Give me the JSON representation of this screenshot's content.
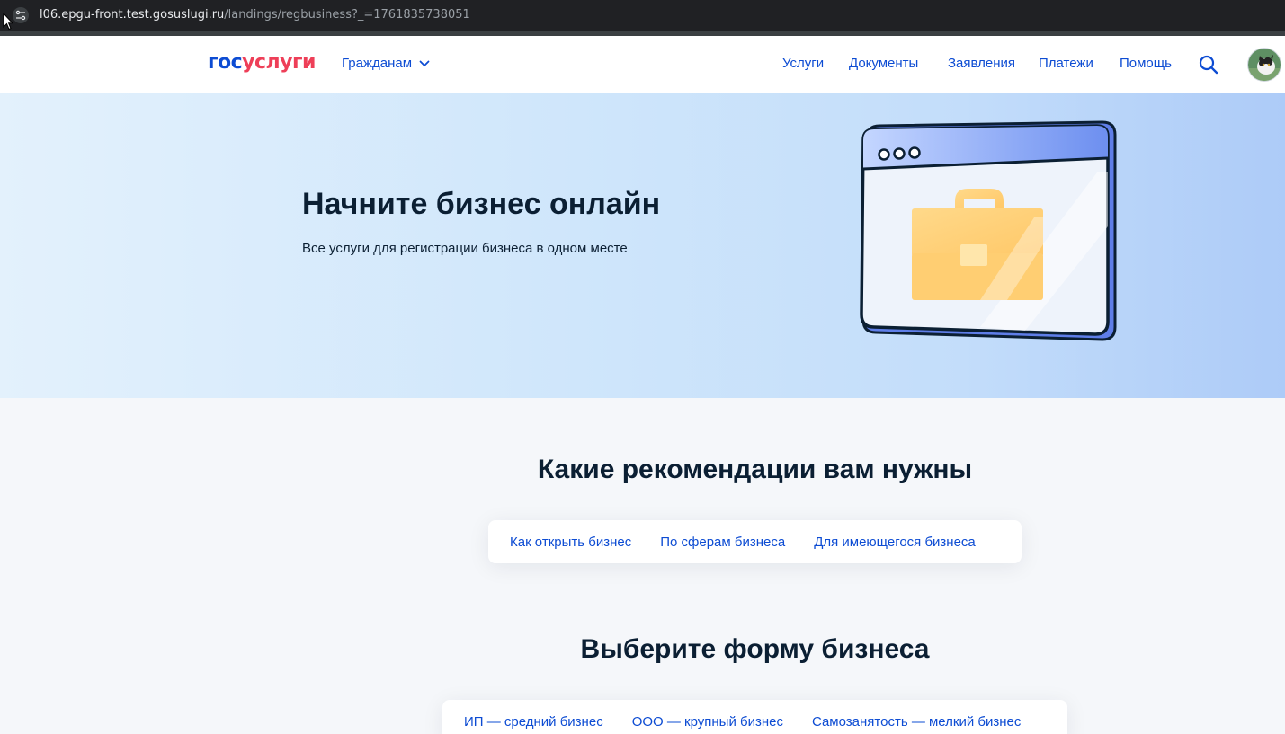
{
  "browser": {
    "url_host": "l06.epgu-front.test.gosuslugi.ru",
    "url_path": "/landings/regbusiness?_=1761835738051"
  },
  "header": {
    "logo_gos": "гос",
    "logo_uslugi": "услуги",
    "audience_label": "Гражданам",
    "nav": [
      "Услуги",
      "Документы",
      "Заявления",
      "Платежи",
      "Помощь"
    ]
  },
  "hero": {
    "title": "Начните бизнес онлайн",
    "subtitle": "Все услуги для регистрации бизнеса в одном месте"
  },
  "recommendations": {
    "title": "Какие рекомендации вам нужны",
    "tabs": [
      "Как открыть бизнес",
      "По сферам бизнеса",
      "Для имеющегося бизнеса"
    ]
  },
  "business_form": {
    "title": "Выберите форму бизнеса",
    "tabs": [
      "ИП — средний бизнес",
      "ООО — крупный бизнес",
      "Самозанятость — мелкий бизнес"
    ]
  },
  "colors": {
    "link": "#0d4cd3",
    "brand_red": "#ee3f58",
    "text": "#0b1f33",
    "hero_gradient_end": "#adcbf8"
  }
}
